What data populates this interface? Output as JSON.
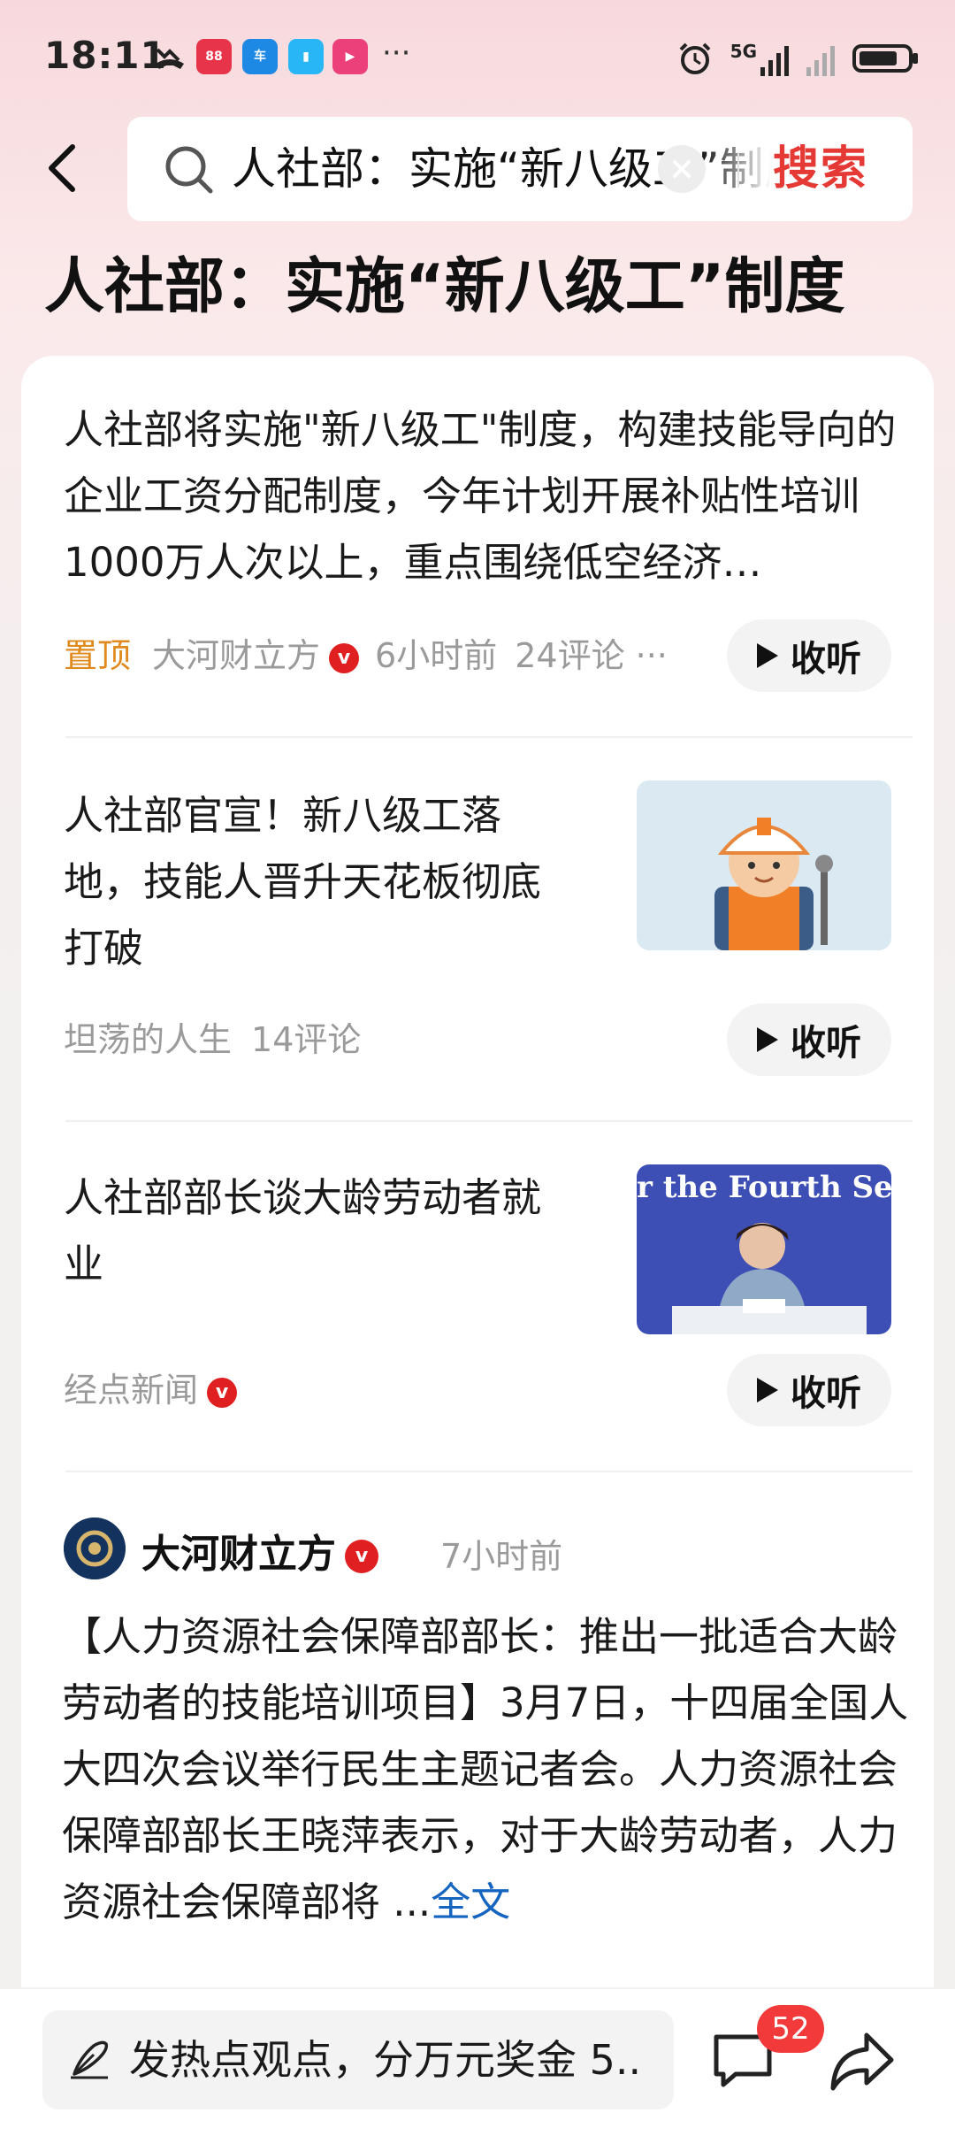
{
  "status_bar": {
    "time": "18:11",
    "app_icons": [
      "missed-call-icon",
      "app-tile-icon",
      "app-tile-icon",
      "book-app-icon",
      "video-app-icon"
    ],
    "overflow": "···",
    "network": "5G",
    "battery_icon": "battery-icon",
    "alarm_icon": "alarm-icon"
  },
  "search": {
    "query": "人社部：实施“新八级工”制度",
    "button_label": "搜索"
  },
  "page_title": "人社部：实施“新八级工”制度",
  "items": [
    {
      "title": "人社部将实施\"新八级工\"制度，构建技能导向的企业工资分配制度，今年计划开展补贴性培训1000万人次以上，重点围绕低空经济…",
      "pinned": "置顶",
      "source": "大河财立方",
      "verified": true,
      "time": "6小时前",
      "comments": "24评论 ···",
      "listen_label": "收听"
    },
    {
      "title": "人社部官宣！新八级工落地，技能人晋升天花板彻底打破",
      "source": "坦荡的人生",
      "comments": "14评论",
      "listen_label": "收听",
      "thumb_icon": "worker-cartoon-image"
    },
    {
      "title": "人社部部长谈大龄劳动者就业",
      "source": "经点新闻",
      "verified": true,
      "listen_label": "收听",
      "thumb_icon": "press-conference-photo",
      "thumb_text": "r the Fourth Se"
    }
  ],
  "post": {
    "author": "大河财立方",
    "verified": true,
    "time": "7小时前",
    "body": "【人力资源社会保障部部长：推出一批适合大龄劳动者的技能培训项目】3月7日，十四届全国人大四次会议举行民生主题记者会。人力资源社会保障部部长王晓萍表示，对于大龄劳动者，人力资源社会保障部将 ...",
    "more_label": "全文"
  },
  "bottom_bar": {
    "comment_placeholder": "发热点观点，分万元奖金 5..",
    "comment_count": "52"
  },
  "colors": {
    "accent_red": "#e53935",
    "pin_orange": "#e08a1e",
    "link_blue": "#1565c0"
  }
}
